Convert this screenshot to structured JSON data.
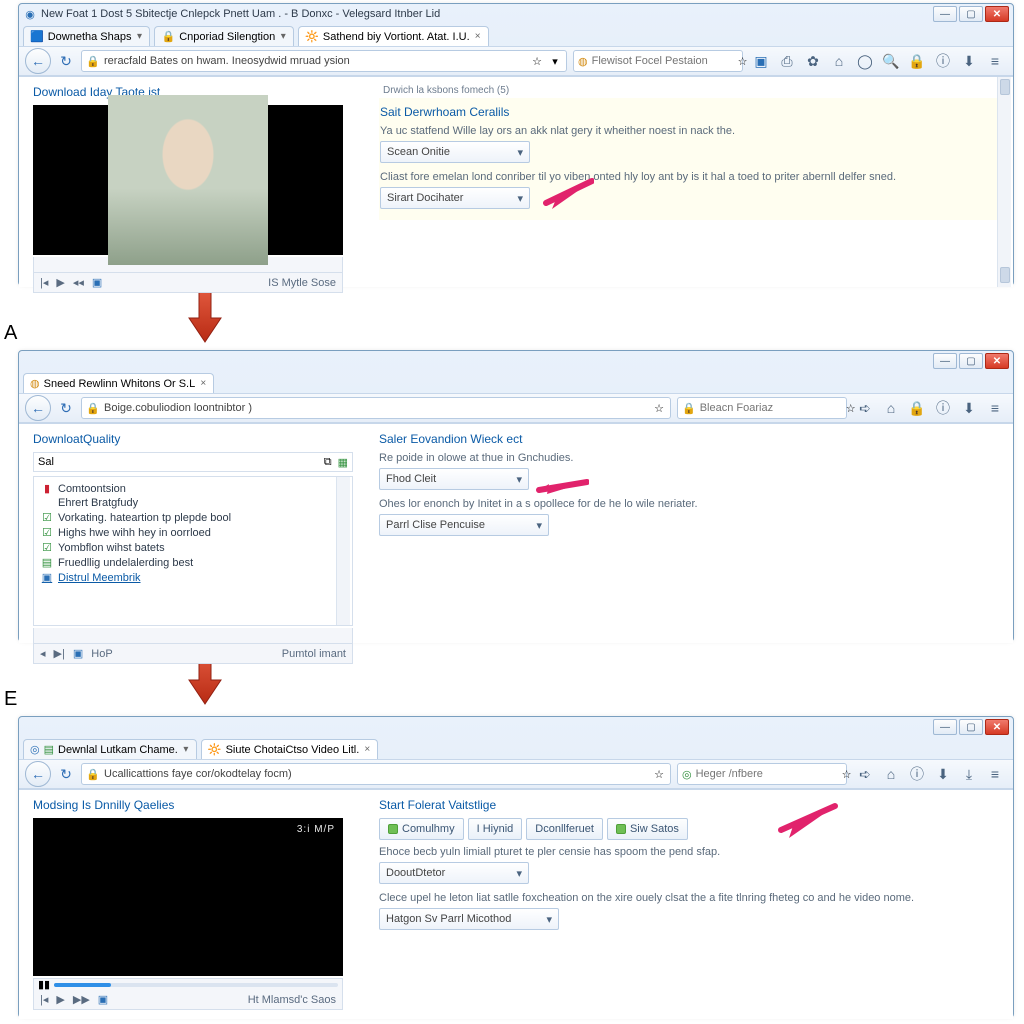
{
  "step_labels": {
    "a": "A",
    "e": "E"
  },
  "panel1": {
    "window_title": "New Foat 1 Dost 5 Sbitectje Cnlepck Pnett Uam . - B Donxc - Velegsard Itnber Lid",
    "tabs": [
      {
        "label": "Downetha Shaps"
      },
      {
        "label": "Cnporiad Silengtion"
      },
      {
        "label": "Sathend biy Vortiont. Atat. I.U."
      }
    ],
    "url": "reracfald Bates on hwam. Ineosydwid mruad ysion",
    "search_ph": "Flewisot Focel Pestaion",
    "left_title": "Download Iday Taote ist",
    "status_right": "IS Mytle Sose",
    "right": {
      "crumb": "Drwich la ksbons fomech (5)",
      "title": "Sait Derwrhoam Ceralils",
      "hint1": "Ya uc statfend Wille lay ors an akk nlat gery it wheither noest in nack the.",
      "dd1": "Scean Onitie",
      "hint2": "Cliast fore emelan lond conriber til yo viben onted hly loy ant by is it hal a toed to priter abernll delfer sned.",
      "dd2": "Sirart Docihater"
    }
  },
  "panel2": {
    "tab": "Sneed Rewlinn Whitons Or S.L",
    "url": "Boige.cobuliodion loontnibtor )",
    "search_ph": "Bleacn Foariaz",
    "left_title": "DownloatQuality",
    "search_val": "Sal",
    "tree": [
      {
        "icon": "folder",
        "text": "Comtoontsion"
      },
      {
        "icon": "none",
        "text": "Ehrert Bratgfudy"
      },
      {
        "icon": "check",
        "text": "Vorkating. hateartion tp plepde bool"
      },
      {
        "icon": "check",
        "text": "Highs hwe wihh hey in oorrloed"
      },
      {
        "icon": "check",
        "text": "Yombflon wihst batets"
      },
      {
        "icon": "doc",
        "text": "Fruedllig undelalerding best"
      },
      {
        "icon": "link",
        "text": "Distrul Meembrik",
        "link": true
      }
    ],
    "status_center": "HoP",
    "status_right": "Pumtol imant",
    "right": {
      "title": "Saler Eovandion Wieck ect",
      "hint1": "Re poide in olowe at thue in Gnchudies.",
      "dd1": "Fhod Cleit",
      "hint2": "Ohes lor enonch by Initet in a s opollece for de he lo wile neriater.",
      "dd2": "Parrl Clise Pencuise"
    }
  },
  "panel3": {
    "tabs": [
      {
        "label": "Dewnlal Lutkam Chame."
      },
      {
        "label": "Siute ChotaiCtso Video Litl."
      }
    ],
    "url": "Ucallicattions faye cor/okodtelay focm)",
    "search_ph": "Heger /nfbere",
    "left_title": "Modsing Is Dnnilly Qaelies",
    "timecode": "3:i M/P",
    "status_right": "Ht Mlamsd'c Saos",
    "right": {
      "title": "Start Folerat Vaitstlige",
      "buttons": [
        "Comulhmy",
        "I Hiynid",
        "Dconllferuet",
        "Siw Satos"
      ],
      "hint1": "Ehoce becb yuln limiall pturet te pler censie has spoom the pend sfap.",
      "dd1": "DooutDtetor",
      "hint2": "Clece upel he leton liat satlle foxcheation on the xire ouely clsat the a fite tlnring fheteg co and he video nome.",
      "dd2": "Hatgon Sv Parrl Micothod"
    }
  }
}
